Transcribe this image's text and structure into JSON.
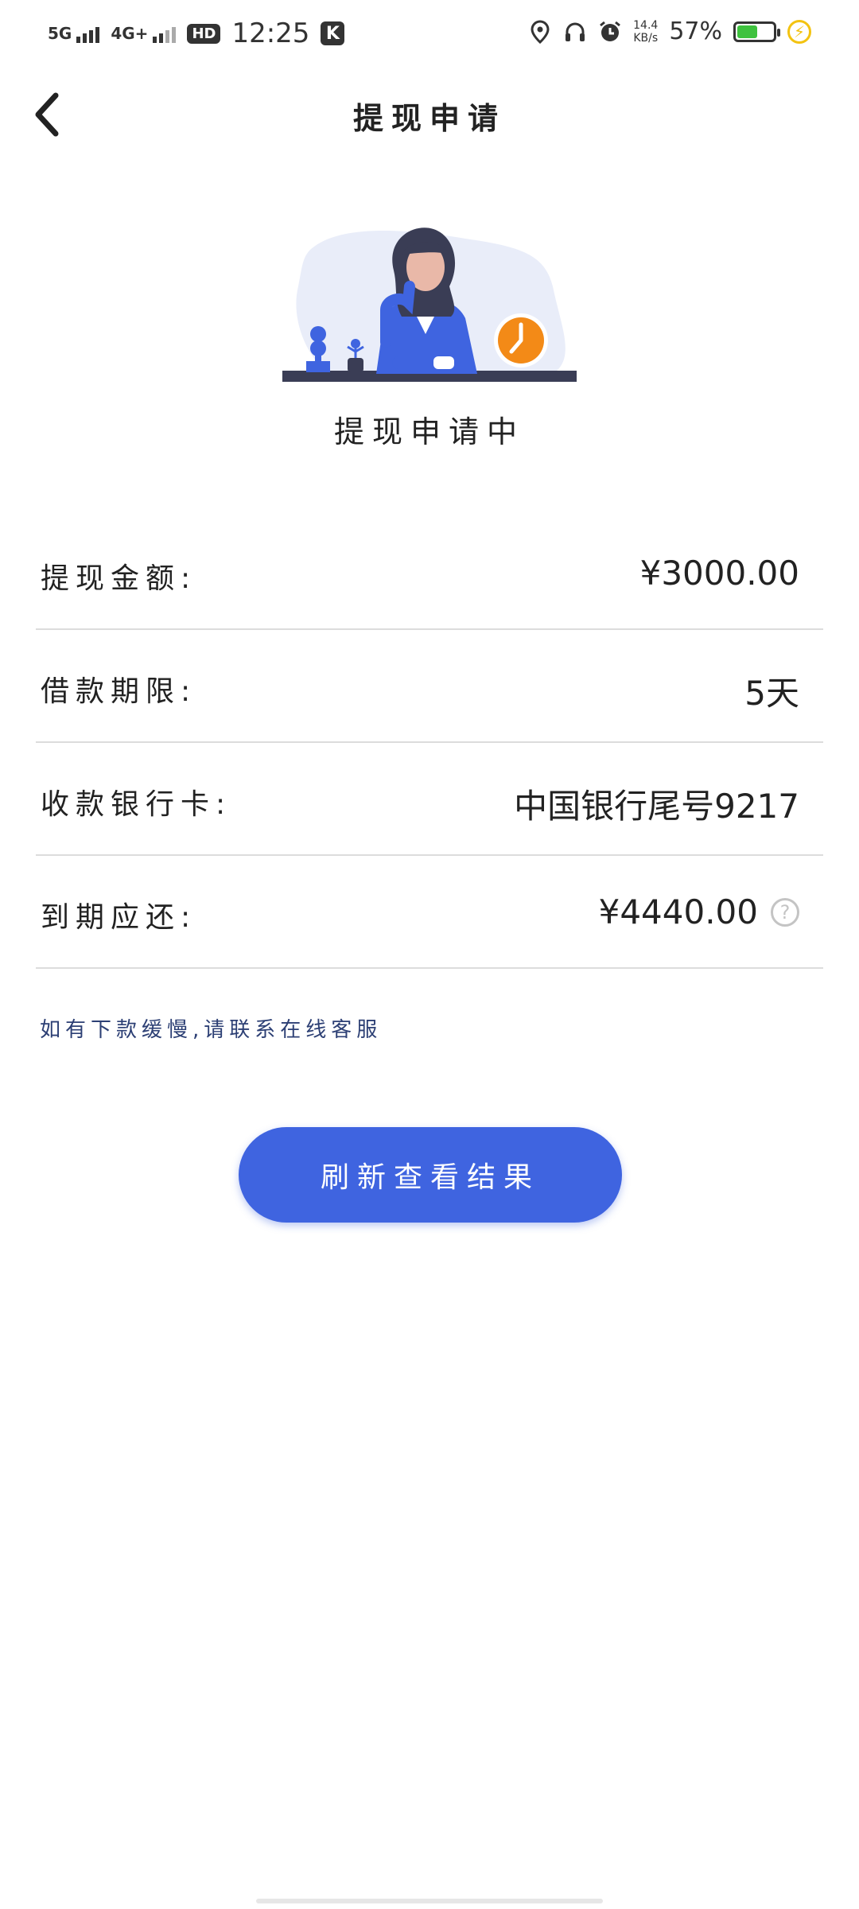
{
  "status_bar": {
    "net1": "5G",
    "net2": "4G+",
    "hd": "HD",
    "time": "12:25",
    "k_icon": "K",
    "speed_value": "14.4",
    "speed_unit": "KB/s",
    "battery_percent": "57%",
    "battery_level": 0.57,
    "icons": [
      "location-icon",
      "headphones-icon",
      "alarm-icon",
      "charging-icon"
    ]
  },
  "nav": {
    "title": "提现申请",
    "back_icon": "chevron-left-icon"
  },
  "status": {
    "caption": "提现申请中"
  },
  "rows": [
    {
      "label": "提现金额:",
      "value": "¥3000.00"
    },
    {
      "label": "借款期限:",
      "value": "5天"
    },
    {
      "label": "收款银行卡:",
      "value": "中国银行尾号9217"
    },
    {
      "label": "到期应还:",
      "value": "¥4440.00"
    }
  ],
  "help_icon_glyph": "?",
  "hint": "如有下款缓慢,请联系在线客服",
  "button": {
    "label": "刷新查看结果"
  },
  "colors": {
    "accent": "#3f64e0",
    "hint_text": "#2c3f74",
    "divider": "#dcdcdc"
  }
}
